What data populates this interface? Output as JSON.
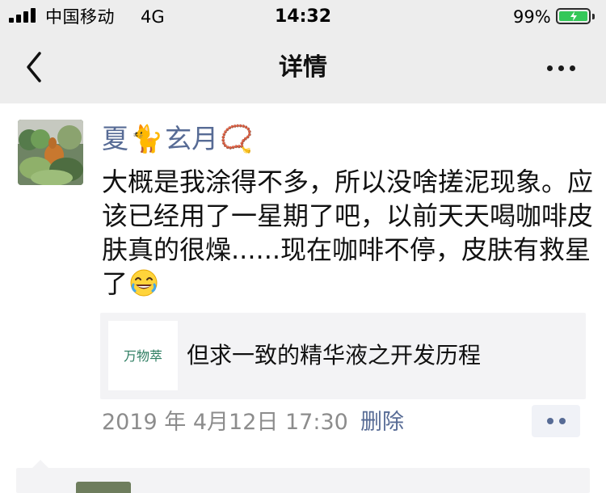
{
  "status_bar": {
    "carrier": "中国移动",
    "network": "4G",
    "time": "14:32",
    "battery_percent": "99%",
    "battery_color": "#34c759"
  },
  "nav": {
    "title": "详情",
    "back_icon": "chevron-left-icon",
    "more_icon": "more-horizontal-icon"
  },
  "post": {
    "author": {
      "name_part1": "夏",
      "name_part2": "玄月",
      "emoji_1": "🐈",
      "emoji_2": "📿"
    },
    "text": "大概是我涂得不多，所以没啥搓泥现象。应该已经用了一星期了吧，以前天天喝咖啡皮肤真的很燥......现在咖啡不停，皮肤有救星了",
    "text_emoji": "laughing-face-icon",
    "link": {
      "thumbnail_text": "万物萃",
      "title": "但求一致的精华液之开发历程"
    },
    "date": "2019 年 4月12日 17:30",
    "delete_label": "删除",
    "comment_icon": "comment-dots-icon"
  },
  "colors": {
    "header_bg": "#ededed",
    "link_blue": "#576b95",
    "panel_bg": "#f3f3f5"
  }
}
